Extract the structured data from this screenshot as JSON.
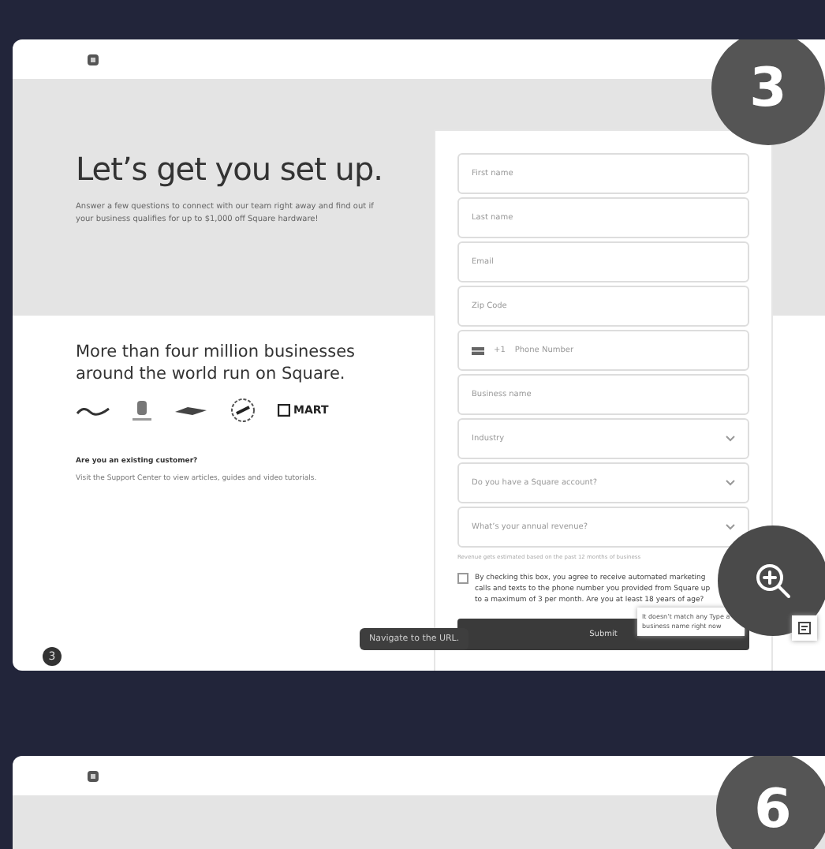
{
  "cards": [
    {
      "step_badge": "3",
      "hero": {
        "title": "Let’s get you set up.",
        "text": "Answer a few questions to connect with our team right away and find out if your business qualifies for up to $1,000 off Square hardware!"
      },
      "trust": {
        "title": "More than four million businesses around the world run on Square.",
        "logo_text": "MART",
        "question": "Are you an existing customer?",
        "help": "Visit the Support Center to view articles, guides and video tutorials."
      },
      "form": {
        "fields": [
          {
            "kind": "text",
            "placeholder": "First name"
          },
          {
            "kind": "text",
            "placeholder": "Last name"
          },
          {
            "kind": "text",
            "placeholder": "Email"
          },
          {
            "kind": "text",
            "placeholder": "Zip Code"
          },
          {
            "kind": "phone",
            "placeholder": "Phone Number",
            "prefix": "+1"
          },
          {
            "kind": "text",
            "placeholder": "Business name"
          },
          {
            "kind": "select",
            "placeholder": "Industry"
          },
          {
            "kind": "select",
            "placeholder": "Do you have a Square account?"
          },
          {
            "kind": "select",
            "placeholder": "What’s your annual revenue?"
          }
        ],
        "note": "Revenue gets estimated based on the past 12 months of business",
        "consent": {
          "checked": false,
          "text": "By checking this box, you agree to receive automated marketing calls and texts to the phone number you provided from Square up to a maximum of 3 per month. Are you at least 18 years of age?"
        },
        "submit": "Submit"
      },
      "page_number": "3",
      "url_tooltip": "Navigate to the URL.",
      "popup": "It doesn’t match any Type a business name right now"
    },
    {
      "step_badge": "6"
    }
  ]
}
